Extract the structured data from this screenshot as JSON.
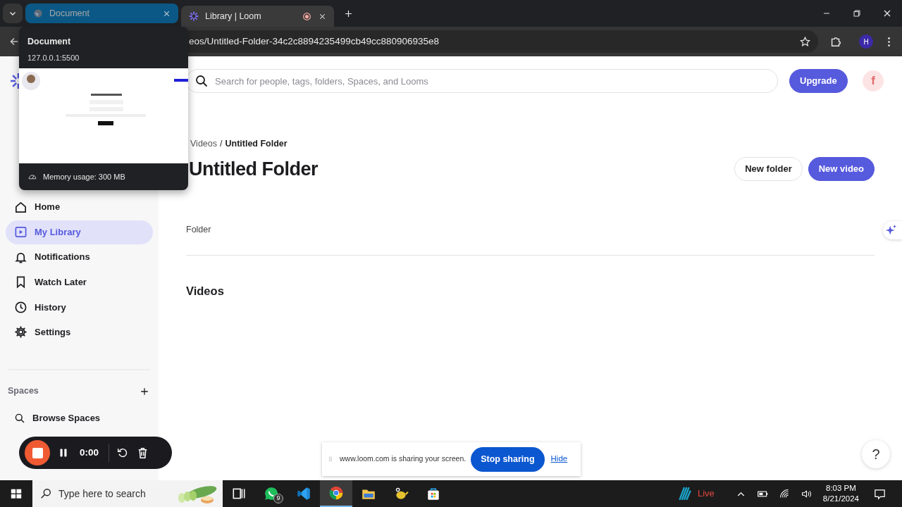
{
  "browser": {
    "tabs": [
      {
        "title": "Document",
        "selected": false,
        "hovered": true,
        "recording": false
      },
      {
        "title": "Library | Loom",
        "selected": true,
        "hovered": false,
        "recording": true
      }
    ],
    "address": "eos/Untitled-Folder-34c2c8894235499cb49cc880906935e8",
    "profile_initial": "H"
  },
  "tab_hover_card": {
    "title": "Document",
    "url": "127.0.0.1:5500",
    "memory": "Memory usage: 300 MB"
  },
  "topbar": {
    "search_placeholder": "Search for people, tags, folders, Spaces, and Looms",
    "upgrade": "Upgrade",
    "user_initial": "f"
  },
  "sidebar": {
    "items": [
      {
        "label": "Home",
        "selected": false
      },
      {
        "label": "My Library",
        "selected": true
      },
      {
        "label": "Notifications",
        "selected": false
      },
      {
        "label": "Watch Later",
        "selected": false
      },
      {
        "label": "History",
        "selected": false
      },
      {
        "label": "Settings",
        "selected": false
      }
    ],
    "spaces_heading": "Spaces",
    "spaces_items": [
      {
        "label": "Browse Spaces"
      }
    ]
  },
  "breadcrumb": {
    "items": [
      {
        "label": "Videos",
        "current": false
      },
      {
        "label": "Untitled Folder",
        "current": true
      }
    ],
    "separator": "/"
  },
  "title": "Untitled Folder",
  "buttons": [
    {
      "label": "New folder",
      "kind": "secondary"
    },
    {
      "label": "New video",
      "kind": "primary"
    }
  ],
  "sections": [
    {
      "label": "Folder",
      "divider": true
    },
    {
      "label": "Videos",
      "divider": false
    }
  ],
  "recorder": {
    "time": "0:00"
  },
  "share_bar": {
    "message": "www.loom.com is sharing your screen.",
    "stop": "Stop sharing",
    "hide": "Hide"
  },
  "help_button": "?",
  "taskbar": {
    "search_placeholder": "Type here to search",
    "apps": [
      {
        "kind": "task-view",
        "active": false
      },
      {
        "kind": "chat",
        "active": false,
        "badge": "9"
      },
      {
        "kind": "code-editor",
        "active": false
      },
      {
        "kind": "browser",
        "active": true
      },
      {
        "kind": "folder",
        "active": false
      },
      {
        "kind": "teapot",
        "active": false
      },
      {
        "kind": "store",
        "active": false
      }
    ],
    "live": "Live",
    "time": "8:03 PM",
    "date": "8/21/2024"
  }
}
